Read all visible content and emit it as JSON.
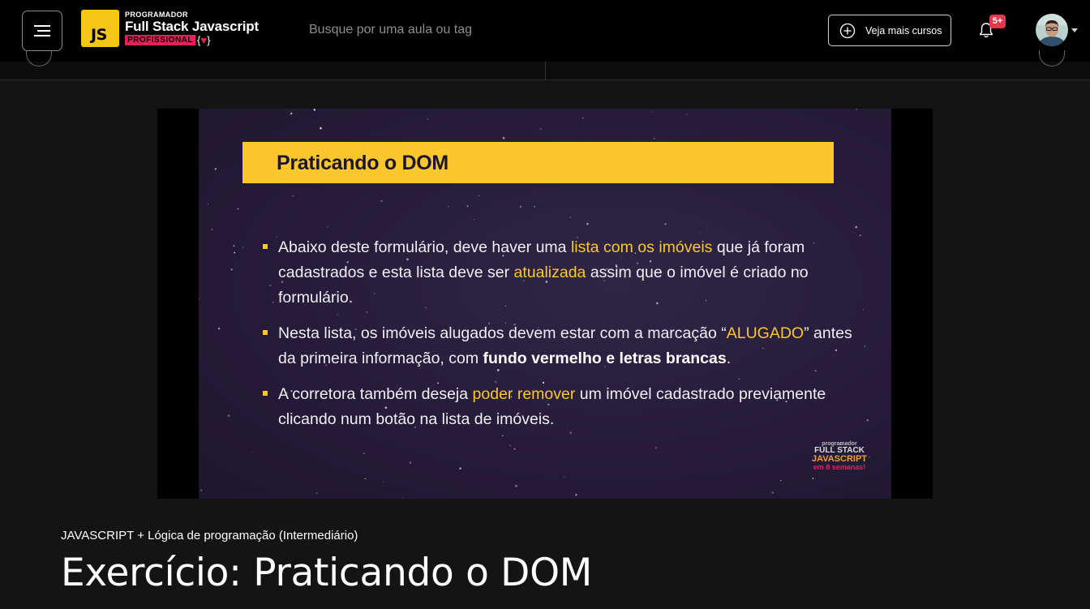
{
  "header": {
    "menu_icon": "hamburger-menu-icon",
    "brand": {
      "badge": "JS",
      "small": "PROGRAMADOR",
      "big": "Full Stack Javascript",
      "pro": "PROFISSIONAL",
      "braces_open": "{",
      "braces_mid": "♥",
      "braces_close": "}"
    },
    "search_placeholder": "Busque por uma aula ou tag",
    "more_courses_label": "Veja mais cursos",
    "notifications_badge": "5+",
    "colors": {
      "accent_yellow": "#fcc72c",
      "brand_pink": "#e8205a",
      "badge_red": "#e8364a"
    }
  },
  "video": {
    "slide_title": "Praticando o DOM",
    "bullets": [
      {
        "parts": [
          {
            "t": "Abaixo deste formulário, deve haver uma ",
            "s": "n"
          },
          {
            "t": "lista com os imóveis",
            "s": "hl"
          },
          {
            "t": " que já foram cadastrados e esta lista deve ser ",
            "s": "n"
          },
          {
            "t": "atualizada",
            "s": "hl"
          },
          {
            "t": " assim que o imóvel é criado no formulário.",
            "s": "n"
          }
        ]
      },
      {
        "parts": [
          {
            "t": "Nesta lista, os imóveis alugados devem estar com a marcação “",
            "s": "n"
          },
          {
            "t": "ALUGADO",
            "s": "hl"
          },
          {
            "t": "” antes da primeira informação, com ",
            "s": "n"
          },
          {
            "t": "fundo vermelho e letras brancas",
            "s": "b"
          },
          {
            "t": ".",
            "s": "n"
          }
        ]
      },
      {
        "parts": [
          {
            "t": "A corretora também deseja ",
            "s": "n"
          },
          {
            "t": "poder remover",
            "s": "hl"
          },
          {
            "t": " um imóvel cadastrado previamente clicando num botão na lista de imóveis.",
            "s": "n"
          }
        ]
      }
    ],
    "watermark": {
      "line1": "programador",
      "line2": "FULL STACK",
      "line3": "JAVASCRIPT",
      "line4": "em 8 semanas!"
    }
  },
  "lesson": {
    "course_name": "JAVASCRIPT + Lógica de programação (Intermediário)",
    "title": "Exercício: Praticando o DOM"
  }
}
